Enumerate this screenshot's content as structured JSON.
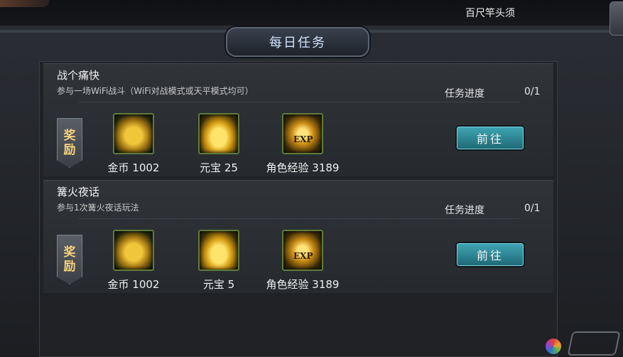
{
  "header": {
    "player_name": "百尺竿头须"
  },
  "panel": {
    "title": "每日任务"
  },
  "tasks": [
    {
      "title": "战个痛快",
      "description": "参与一场WiFi战斗（WiFi对战模式或天平模式均可）",
      "progress_label": "任务进度",
      "progress": "0/1",
      "reward_banner": [
        "奖",
        "励"
      ],
      "rewards": [
        {
          "icon": "gold-coins-icon",
          "label": "金币 1002"
        },
        {
          "icon": "gold-ingot-icon",
          "label": "元宝 25"
        },
        {
          "icon": "exp-icon",
          "label": "角色经验 3189",
          "icon_text": "EXP"
        }
      ],
      "go_label": "前往"
    },
    {
      "title": "篝火夜话",
      "description": "参与1次篝火夜话玩法",
      "progress_label": "任务进度",
      "progress": "0/1",
      "reward_banner": [
        "奖",
        "励"
      ],
      "rewards": [
        {
          "icon": "gold-coins-icon",
          "label": "金币 1002"
        },
        {
          "icon": "gold-ingot-icon",
          "label": "元宝 5"
        },
        {
          "icon": "exp-icon",
          "label": "角色经验 3189",
          "icon_text": "EXP"
        }
      ],
      "go_label": "前往"
    }
  ],
  "colors": {
    "accent_button": "#2a8a99",
    "reward_text": "#f6d27a"
  }
}
